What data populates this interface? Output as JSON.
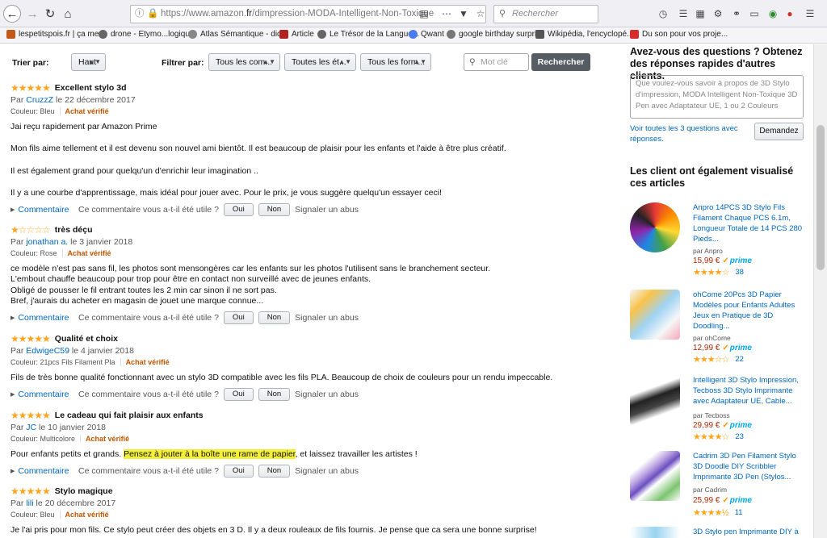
{
  "browser": {
    "url_prefix": "https://www.amazon.",
    "url_domain": "fr",
    "url_path": "/dimpression-MODA-Intelligent-Non-Toxique",
    "search_placeholder": "Rechercher",
    "bookmarks": [
      {
        "label": "lespetitspois.fr | ça me...",
        "color": "#c45a1a"
      },
      {
        "label": "drone - Etymo...logique!",
        "color": "#666666"
      },
      {
        "label": "Atlas Sémantique - dic...",
        "color": "#888888"
      },
      {
        "label": "Article",
        "color": "#b22222"
      },
      {
        "label": "Le Trésor de la Langue...",
        "color": "#666666"
      },
      {
        "label": "Qwant",
        "color": "#4b7bec"
      },
      {
        "label": "google birthday surpri...",
        "color": "#777777"
      },
      {
        "label": "Wikipédia, l'encyclopé...",
        "color": "#555555"
      },
      {
        "label": "Du son pour vos proje...",
        "color": "#d62c2c"
      }
    ]
  },
  "filters": {
    "sort_label": "Trier par:",
    "sort_value": "Haut",
    "filter_label": "Filtrer par:",
    "filter1": "Tous les com...",
    "filter2": "Toutes les ét...",
    "filter3": "Tous les form...",
    "keyword_placeholder": "Mot clé",
    "search_button": "Rechercher"
  },
  "review_labels": {
    "comment": "Commentaire",
    "helpful": "Ce commentaire vous a-t-il été utile ?",
    "yes": "Oui",
    "no": "Non",
    "abuse": "Signaler un abus",
    "by": "Par",
    "verified": "Achat vérifié"
  },
  "reviews": [
    {
      "rating": 5,
      "title": "Excellent stylo 3d",
      "author": "CruzzZ",
      "date": "le 22 décembre 2017",
      "variant": "Couleur: Bleu",
      "verified": true,
      "paragraphs": [
        "Jai reçu rapidement par Amazon Prime",
        "Mon fils aime tellement et il est devenu son nouvel ami bientôt. Il est beaucoup de plaisir pour les enfants et l'aide à être plus créatif.",
        "Il est également grand pour quelqu'un d'enrichir leur imagination ..",
        "Il y a une courbe d'apprentissage, mais idéal pour jouer avec. Pour le prix, je vous suggère quelqu'un essayer ceci!"
      ]
    },
    {
      "rating": 1,
      "title": "très déçu",
      "author": "jonathan a.",
      "date": "le 3 janvier 2018",
      "variant": "Couleur: Rose",
      "verified": true,
      "paragraphs": [
        "ce modèle n'est pas sans fil, les photos sont mensongères car les enfants sur les photos l'utilisent sans le branchement secteur.",
        "L'embout chauffe beaucoup pour trop pour être en contact non surveillé avec de jeunes enfants.",
        "Obligé de pousser le fil entrant toutes les 2 min car sinon il ne sort pas.",
        "Bref, j'aurais du acheter en magasin de jouet une marque connue..."
      ]
    },
    {
      "rating": 5,
      "title": "Qualité et choix",
      "author": "EdwigeC59",
      "date": "le 4 janvier 2018",
      "variant": "Couleur: 21pcs Fils Filament Pla",
      "verified": true,
      "paragraphs": [
        "Fils de très bonne qualité fonctionnant avec un stylo 3D compatible avec les fils PLA. Beaucoup de choix de couleurs pour un rendu impeccable."
      ]
    },
    {
      "rating": 5,
      "title": "Le cadeau qui fait plaisir aux enfants",
      "author": "JC",
      "date": "le 10 janvier 2018",
      "variant": "Couleur: Multicolore",
      "verified": true,
      "text_before": "Pour enfants petits et grands.",
      "text_highlight": "Pensez à jouter à la boîte une rame de papier",
      "text_after": ", et laissez travailler les artistes !"
    },
    {
      "rating": 5,
      "title": "Stylo magique",
      "author": "lili",
      "date": "le 20 décembre 2017",
      "variant": "Couleur: Bleu",
      "verified": true,
      "paragraphs": [
        "Je l'ai pris pour mon fils. Ce stylo peut créer des objets en 3 D. Il y a deux rouleaux de fils fournis. Je pense que ca sera une bonne surprise!"
      ]
    }
  ],
  "questions": {
    "heading": "Avez-vous des questions ? Obtenez des réponses rapides d'autres clients.",
    "placeholder": "Que voulez-vous savoir à propos de 3D Stylo d'impression, MODA Intelligent Non-Toxique 3D Pen avec Adaptateur UE, 1 ou 2 Couleurs",
    "link": "Voir toutes les 3 questions avec réponses.",
    "ask_button": "Demandez"
  },
  "also_viewed": {
    "heading": "Les client ont également visualisé ces articles",
    "products": [
      {
        "title": "Anpro 14PCS 3D Stylo Fils Filament Chaque PCS 6.1m, Longueur Totale de 14 PCS 280 Pieds...",
        "by": "par Anpro",
        "price": "15,99 €",
        "prime": "prime",
        "rating": 4,
        "count": "38"
      },
      {
        "title": "ohCome 20Pcs 3D Papier Modèles pour Enfants Adultes Jeux en Pratique de 3D Doodling...",
        "by": "par ohCome",
        "price": "12,99 €",
        "prime": "prime",
        "rating": 3,
        "count": "22"
      },
      {
        "title": "Intelligent 3D Stylo Impression, Tecboss 3D Stylo Imprimante avec Adaptateur UE, Cable...",
        "by": "par Tecboss",
        "price": "29,99 €",
        "prime": "prime",
        "rating": 4,
        "count": "23"
      },
      {
        "title": "Cadrim 3D Pen Filament Stylo 3D Doodle DIY Scribbler Imprimante 3D Pen (Stylos...",
        "by": "par Cadrim",
        "price": "25,99 €",
        "prime": "prime",
        "rating": 4.5,
        "count": "11"
      },
      {
        "title": "3D Stylo pen Imprimante DIY à"
      }
    ]
  }
}
